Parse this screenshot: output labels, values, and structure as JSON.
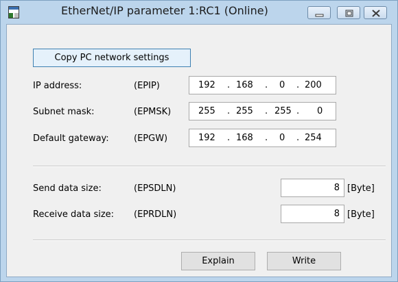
{
  "window": {
    "title": "EtherNet/IP parameter 1:RC1 (Online)",
    "icons": {
      "app": "app-window-icon",
      "minimize": "minimize-icon",
      "maximize": "maximize-icon",
      "close": "close-icon"
    }
  },
  "toolbar": {
    "copy_label": "Copy PC network settings"
  },
  "network": {
    "ip": {
      "label": "IP address:",
      "code": "(EPIP)",
      "octets": [
        "192",
        "168",
        "0",
        "200"
      ]
    },
    "subnet": {
      "label": "Subnet mask:",
      "code": "(EPMSK)",
      "octets": [
        "255",
        "255",
        "255",
        "0"
      ]
    },
    "gateway": {
      "label": "Default gateway:",
      "code": "(EPGW)",
      "octets": [
        "192",
        "168",
        "0",
        "254"
      ]
    }
  },
  "data_size": {
    "send": {
      "label": "Send data size:",
      "code": "(EPSDLN)",
      "value": "8",
      "unit": "[Byte]"
    },
    "receive": {
      "label": "Receive data size:",
      "code": "(EPRDLN)",
      "value": "8",
      "unit": "[Byte]"
    }
  },
  "actions": {
    "explain_label": "Explain",
    "write_label": "Write"
  },
  "colors": {
    "title_bar": "#bcd5ec",
    "dialog_bg": "#f0f0f0",
    "default_button_border": "#3c7fb1"
  }
}
